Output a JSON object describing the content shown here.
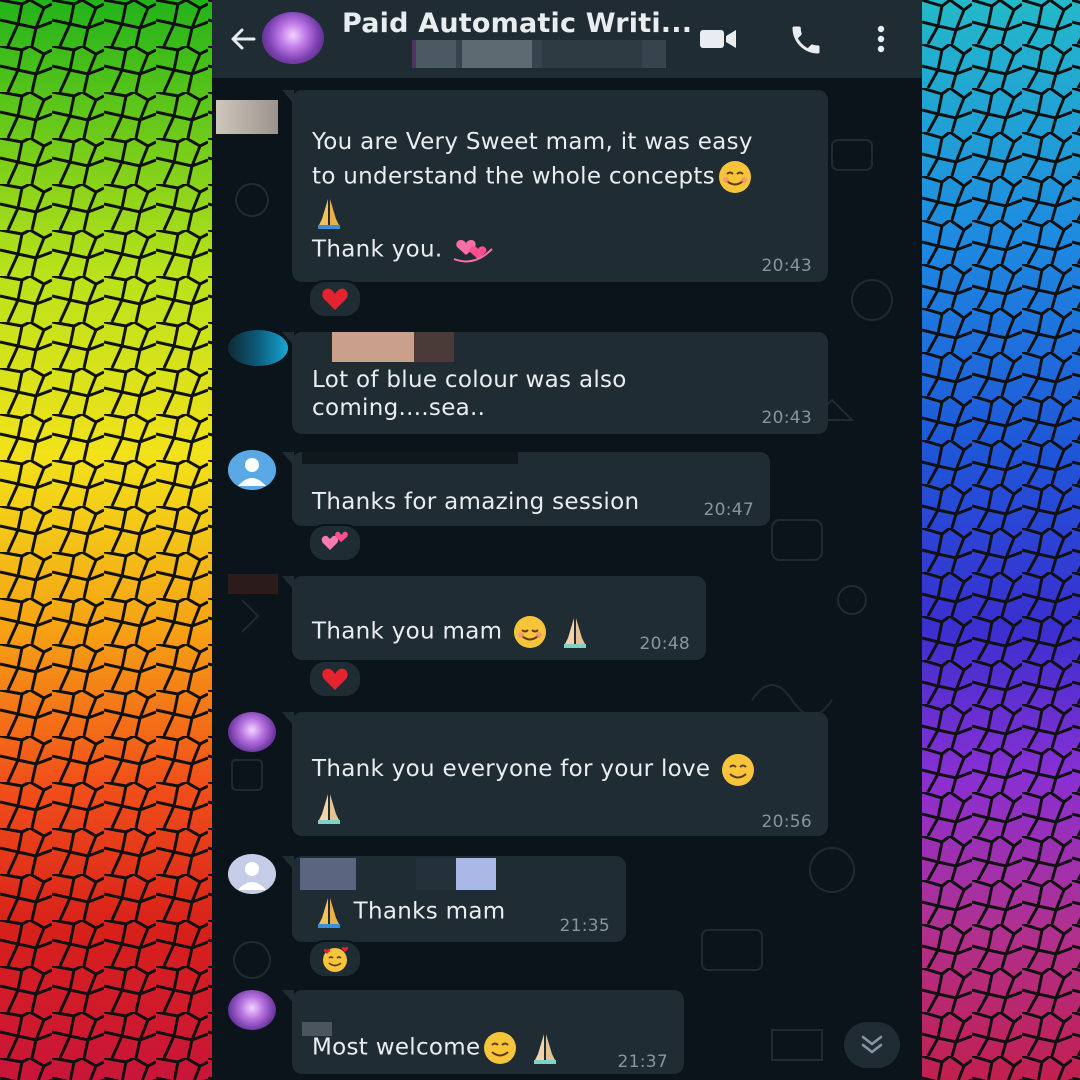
{
  "chat": {
    "title": "Paid Automatic Writi...",
    "header_icons": [
      "arrow-left-icon",
      "video-camera-icon",
      "phone-icon",
      "more-vert-icon"
    ]
  },
  "messages": [
    {
      "line1": "You are Very Sweet mam, it was easy",
      "line2": "to understand the whole concepts",
      "line3": "Thank you.",
      "time": "20:43",
      "reaction": "heart-emoji"
    },
    {
      "line1": "Lot of blue colour was also",
      "line2": "coming....sea..",
      "time": "20:43"
    },
    {
      "line1": "Thanks for amazing session",
      "time": "20:47",
      "reaction": "two-hearts-emoji"
    },
    {
      "line1": "Thank you mam",
      "time": "20:48",
      "reaction": "heart-emoji"
    },
    {
      "line1": "Thank you everyone for your love",
      "time": "20:56"
    },
    {
      "line1": "Thanks mam",
      "time": "21:35",
      "reaction": "smiling-face-with-hearts-emoji"
    },
    {
      "line1": "Most welcome",
      "time": "21:37"
    }
  ],
  "colors": {
    "chat_bg": "#0b141a",
    "bubble": "#202c33",
    "header": "#1f2c34",
    "text": "#e9edef",
    "time": "#8696a0"
  }
}
